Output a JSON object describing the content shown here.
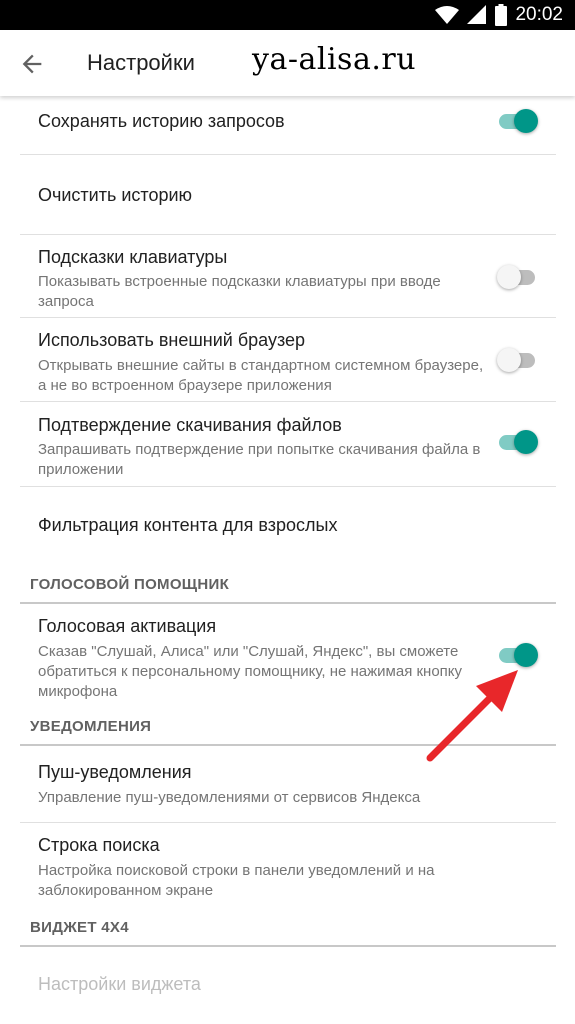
{
  "status_bar": {
    "time": "20:02"
  },
  "toolbar": {
    "title": "Настройки",
    "watermark": "ya-alisa.ru"
  },
  "colors": {
    "accent": "#009688",
    "accent_track": "#80cbc4",
    "arrow": "#e8272a"
  },
  "settings": [
    {
      "title": "Сохранять историю запросов",
      "enabled": true
    },
    {
      "title": "Очистить историю"
    },
    {
      "title": "Подсказки клавиатуры",
      "summary": "Показывать встроенные подсказки клавиатуры при вводе запроса",
      "enabled": false
    },
    {
      "title": "Использовать внешний браузер",
      "summary": "Открывать внешние сайты в стандартном системном браузере, а не во встроенном браузере приложения",
      "enabled": false
    },
    {
      "title": "Подтверждение скачивания файлов",
      "summary": "Запрашивать подтверждение при попытке скачивания файла в приложении",
      "enabled": true
    },
    {
      "title": "Фильтрация контента для взрослых"
    }
  ],
  "sections": {
    "voice": {
      "header": "ГОЛОСОВОЙ ПОМОЩНИК",
      "activation": {
        "title": "Голосовая активация",
        "summary": "Сказав \"Слушай, Алиса\" или \"Слушай, Яндекс\", вы сможете обратиться к персональному помощнику, не нажимая кнопку микрофона",
        "enabled": true
      }
    },
    "notifications": {
      "header": "УВЕДОМЛЕНИЯ",
      "push": {
        "title": "Пуш-уведомления",
        "summary": "Управление пуш-уведомлениями от сервисов Яндекса"
      },
      "search_bar": {
        "title": "Строка поиска",
        "summary": "Настройка поисковой строки в панели уведомлений и на заблокированном экране"
      }
    },
    "widget": {
      "header": "ВИДЖЕТ 4Х4",
      "settings": {
        "title": "Настройки виджета",
        "disabled": true
      }
    }
  }
}
